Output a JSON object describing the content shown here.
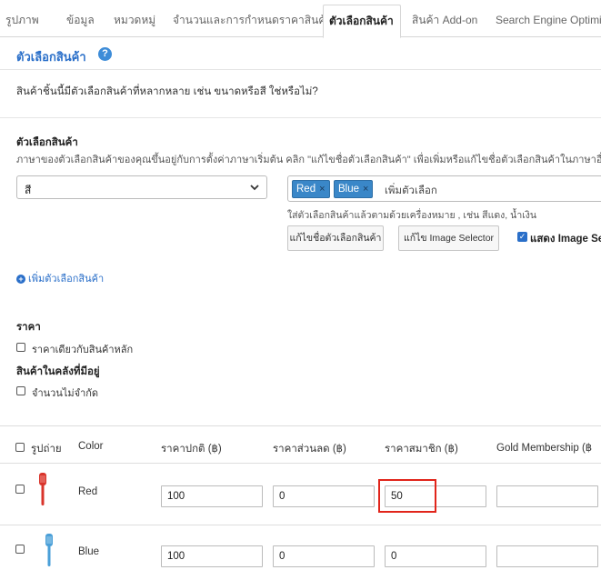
{
  "tabs": [
    "รูปภาพ",
    "ข้อมูล",
    "หมวดหมู่",
    "จำนวนและการกำหนดราคาสินค้า",
    "ตัวเลือกสินค้า",
    "สินค้า Add-on",
    "Search Engine Optimiz"
  ],
  "active_tab": "ตัวเลือกสินค้า",
  "section": {
    "title": "ตัวเลือกสินค้า",
    "question": "สินค้าชิ้นนี้มีตัวเลือกสินค้าที่หลากหลาย เช่น ขนาดหรือสี ใช่หรือไม่?"
  },
  "options": {
    "label": "ตัวเลือกสินค้า",
    "description": "ภาษาของตัวเลือกสินค้าของคุณขึ้นอยู่กับการตั้งค่าภาษาเริ่มต้น คลิก \"แก้ไขชื่อตัวเลือกสินค้า\" เพื่อเพิ่มหรือแก้ไขชื่อตัวเลือกสินค้าในภาษาอื่นๆ",
    "select_value": "สี",
    "tags": [
      "Red",
      "Blue"
    ],
    "tag_remove_glyph": "×",
    "tag_placeholder": "เพิ่มตัวเลือก",
    "hint": "ใส่ตัวเลือกสินค้าแล้วตามด้วยเครื่องหมาย , เช่น สีแดง, น้ำเงิน",
    "edit_name_button": "แก้ไขชื่อตัวเลือกสินค้า",
    "edit_image_selector_button": "แก้ไข Image Selector",
    "show_image_selector_label": "แสดง Image Sel",
    "show_image_selector_checked": true,
    "add_option_link": "เพิ่มตัวเลือกสินค้า"
  },
  "price": {
    "label": "ราคา",
    "same_price_label": "ราคาเดียวกับสินค้าหลัก"
  },
  "stock": {
    "label": "สินค้าในคลังที่มีอยู่",
    "unlimited_label": "จำนวนไม่จำกัด"
  },
  "table": {
    "headers": {
      "image": "รูปถ่าย",
      "color": "Color",
      "regular_price": "ราคาปกติ (฿)",
      "discount_price": "ราคาส่วนลด (฿)",
      "member_price": "ราคาสมาชิก (฿)",
      "gold": "Gold Membership (฿"
    },
    "rows": [
      {
        "color": "Red",
        "swatch": "#d9342b",
        "regular": "100",
        "discount": "0",
        "member": "50",
        "gold": ""
      },
      {
        "color": "Blue",
        "swatch": "#4a9fd8",
        "regular": "100",
        "discount": "0",
        "member": "0",
        "gold": ""
      }
    ]
  },
  "colors": {
    "accent": "#2a6fc9",
    "tag": "#3a87c8",
    "highlight": "#e1251b"
  }
}
